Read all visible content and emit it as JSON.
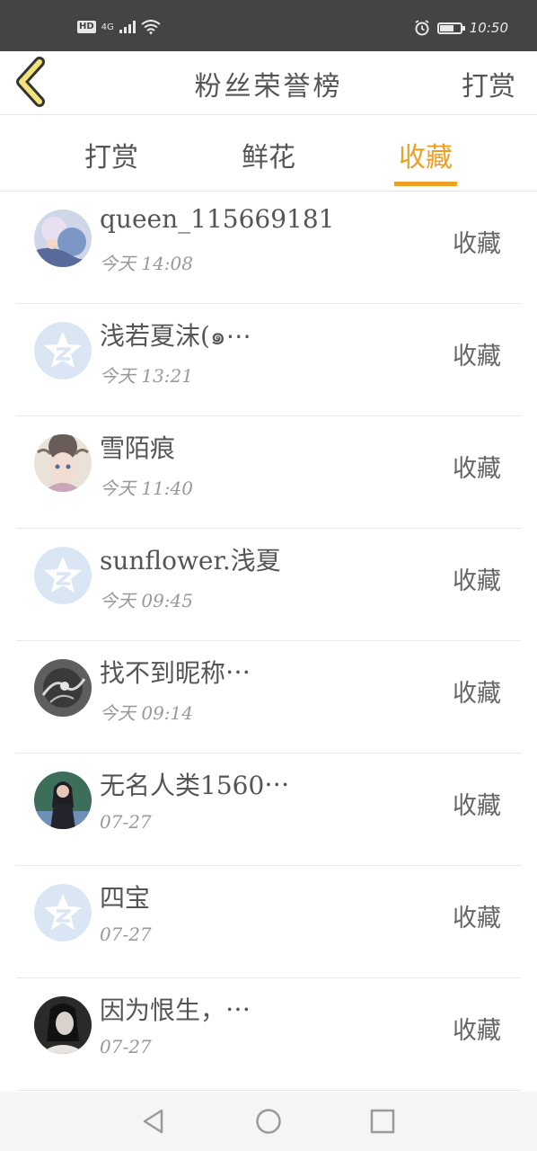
{
  "status_bar": {
    "hd": "HD",
    "network": "4G",
    "time": "10:50"
  },
  "header": {
    "title": "粉丝荣誉榜",
    "action_label": "打赏"
  },
  "tabs": [
    {
      "label": "打赏",
      "active": false
    },
    {
      "label": "鲜花",
      "active": false
    },
    {
      "label": "收藏",
      "active": true
    }
  ],
  "fans": [
    {
      "name": "queen_115669181",
      "time": "今天 14:08",
      "action": "收藏",
      "avatar": "photo-anime-blue"
    },
    {
      "name": "浅若夏沫(๑⋯",
      "time": "今天 13:21",
      "action": "收藏",
      "avatar": "default-qzone"
    },
    {
      "name": "雪陌痕",
      "time": "今天 11:40",
      "action": "收藏",
      "avatar": "photo-anime-girl"
    },
    {
      "name": "sunflower.浅夏",
      "time": "今天 09:45",
      "action": "收藏",
      "avatar": "default-qzone"
    },
    {
      "name": "找不到昵称⋯",
      "time": "今天 09:14",
      "action": "收藏",
      "avatar": "photo-ink-dark"
    },
    {
      "name": "无名人类1560⋯",
      "time": "07-27",
      "action": "收藏",
      "avatar": "photo-costume-man"
    },
    {
      "name": "四宝",
      "time": "07-27",
      "action": "收藏",
      "avatar": "default-qzone"
    },
    {
      "name": "因为恨生，⋯",
      "time": "07-27",
      "action": "收藏",
      "avatar": "photo-girl-dark"
    }
  ],
  "colors": {
    "accent": "#f0a020",
    "status_bar": "#444444",
    "default_avatar": "#dbe6f4"
  }
}
